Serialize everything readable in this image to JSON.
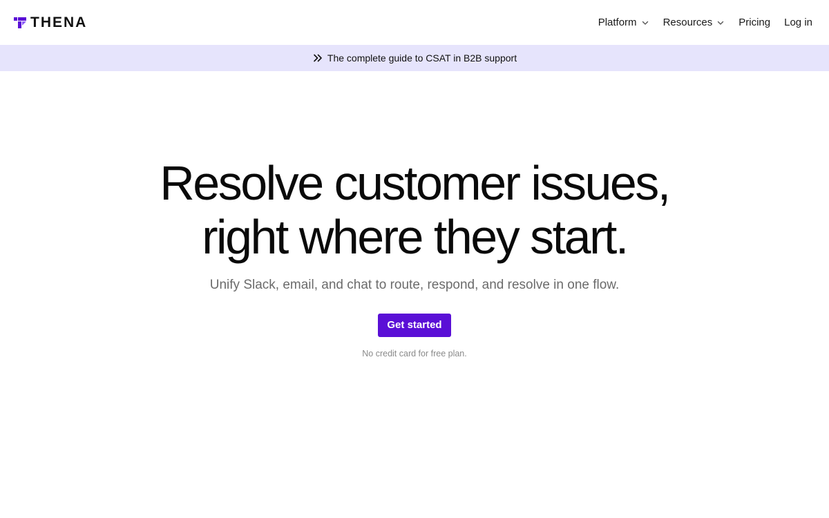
{
  "brand": {
    "name": "THENA",
    "icon": "thena-logo-icon",
    "color": "#5a0fd6"
  },
  "nav": {
    "items": [
      {
        "label": "Platform",
        "has_dropdown": true
      },
      {
        "label": "Resources",
        "has_dropdown": true
      },
      {
        "label": "Pricing",
        "has_dropdown": false
      },
      {
        "label": "Log in",
        "has_dropdown": false
      }
    ]
  },
  "banner": {
    "icon": "double-chevron-right-icon",
    "text": "The complete guide to CSAT in B2B support",
    "background": "#e6e4fc"
  },
  "hero": {
    "title_line1": "Resolve customer issues,",
    "title_line2": "right where they start.",
    "subtitle": "Unify Slack, email, and chat to route, respond, and resolve in one flow.",
    "cta_label": "Get started",
    "cta_color": "#5a0fd6",
    "note": "No credit card for free plan."
  }
}
